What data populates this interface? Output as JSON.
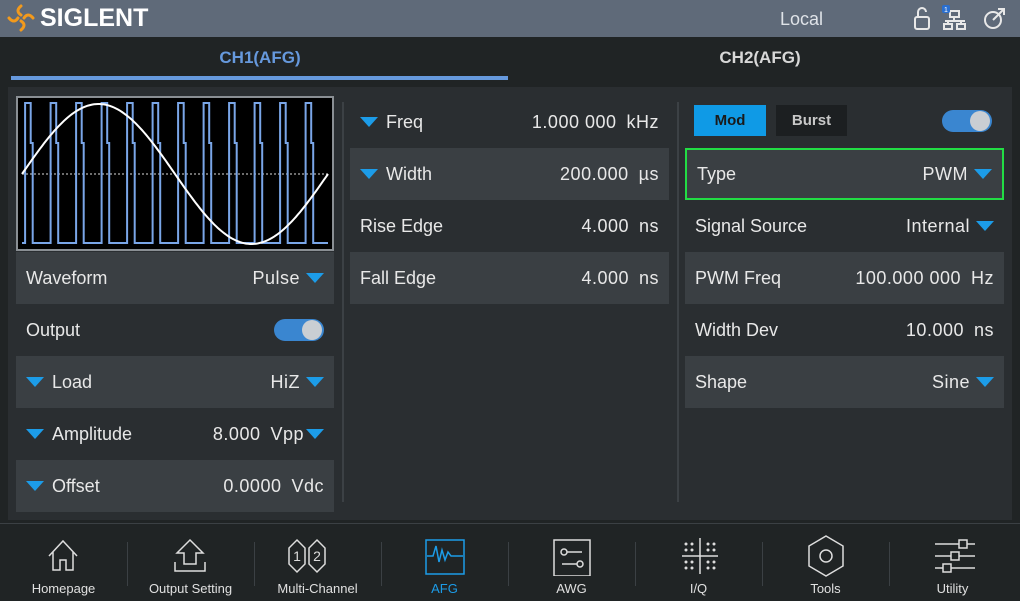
{
  "header": {
    "brand": "SIGLENT",
    "mode": "Local",
    "lan_badge": "1"
  },
  "tabs": [
    {
      "label": "CH1(AFG)",
      "active": true
    },
    {
      "label": "CH2(AFG)",
      "active": false
    }
  ],
  "left": {
    "waveform": {
      "label": "Waveform",
      "value": "Pulse"
    },
    "output": {
      "label": "Output",
      "on": true
    },
    "load": {
      "label": "Load",
      "value": "HiZ"
    },
    "amplitude": {
      "label": "Amplitude",
      "value": "8.000",
      "unit": "Vpp"
    },
    "offset": {
      "label": "Offset",
      "value": "0.0000",
      "unit": "Vdc"
    }
  },
  "middle": {
    "freq": {
      "label": "Freq",
      "value": "1.000 000",
      "unit": "kHz"
    },
    "width": {
      "label": "Width",
      "value": "200.000",
      "unit": "µs"
    },
    "rise": {
      "label": "Rise Edge",
      "value": "4.000",
      "unit": "ns"
    },
    "fall": {
      "label": "Fall Edge",
      "value": "4.000",
      "unit": "ns"
    }
  },
  "right": {
    "mod_label": "Mod",
    "burst_label": "Burst",
    "enabled": true,
    "type": {
      "label": "Type",
      "value": "PWM"
    },
    "source": {
      "label": "Signal Source",
      "value": "Internal"
    },
    "pwm_freq": {
      "label": "PWM Freq",
      "value": "100.000 000",
      "unit": "Hz"
    },
    "width_dev": {
      "label": "Width Dev",
      "value": "10.000",
      "unit": "ns"
    },
    "shape": {
      "label": "Shape",
      "value": "Sine"
    }
  },
  "nav": [
    "Homepage",
    "Output Setting",
    "Multi-Channel",
    "AFG",
    "AWG",
    "I/Q",
    "Tools",
    "Utility"
  ],
  "colors": {
    "accent": "#1c9ce8",
    "header": "#5f6a79",
    "focus": "#22dd44",
    "tab_active": "#6699dd"
  }
}
